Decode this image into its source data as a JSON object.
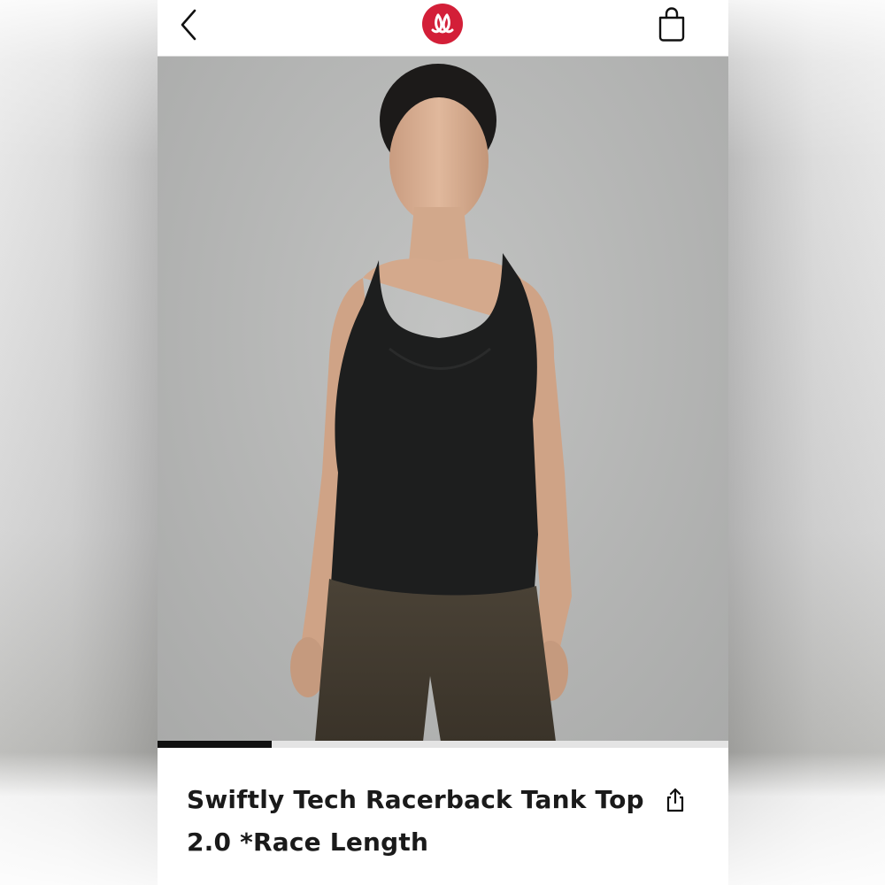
{
  "header": {
    "back_icon": "chevron-left-icon",
    "logo_icon": "lululemon-logo",
    "bag_icon": "shopping-bag-icon",
    "brand_color": "#d31f38"
  },
  "gallery": {
    "image_description_icon": "product-photo",
    "progress": 0.2
  },
  "product": {
    "title_line1": "Swiftly Tech Racerback Tank Top",
    "title_line2": "2.0 *Race Length",
    "share_icon": "share-icon"
  }
}
